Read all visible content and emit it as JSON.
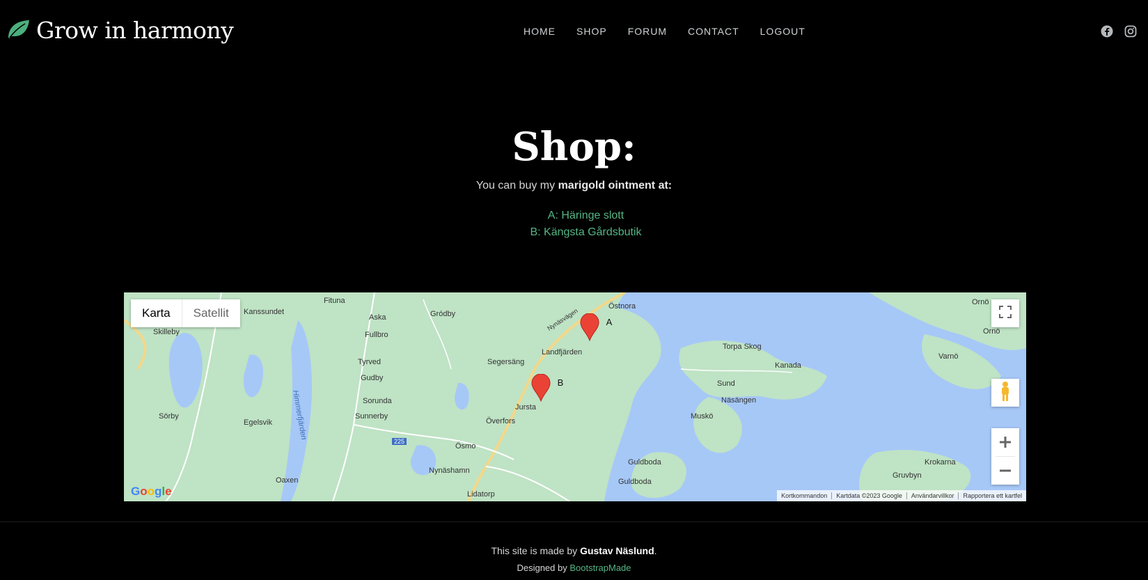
{
  "brand": {
    "name": "Grow in harmony",
    "accent": "#4caf7d"
  },
  "nav": [
    {
      "label": "HOME"
    },
    {
      "label": "SHOP"
    },
    {
      "label": "FORUM"
    },
    {
      "label": "CONTACT"
    },
    {
      "label": "LOGOUT"
    }
  ],
  "social": [
    "facebook-icon",
    "instagram-icon"
  ],
  "page": {
    "title": "Shop:",
    "intro_prefix": "You can buy my ",
    "intro_bold": "marigold ointment at:",
    "locations": [
      "A: Häringe slott",
      "B: Kängsta Gårdsbutik"
    ]
  },
  "map": {
    "type_buttons": {
      "map": "Karta",
      "satellite": "Satellit"
    },
    "markers": [
      {
        "label": "A"
      },
      {
        "label": "B"
      }
    ],
    "place_labels": [
      "Fituna",
      "Askа",
      "Gródby",
      "Östnora",
      "Ornö",
      "Kanssundet",
      "Skilleby",
      "Fullbro",
      "Nynäsvägen",
      "Landfjärden",
      "Segersäng",
      "Torpa Skog",
      "Kanada",
      "Varnö",
      "Tyrved",
      "Gudby",
      "Sorunda",
      "Sunnerby",
      "Jursta",
      "Överfors",
      "Sund",
      "Näsängen",
      "Muskö",
      "Sörby",
      "Egelsvik",
      "Himmerfjärden",
      "Ösmo",
      "Nynäshamn",
      "Guldboda",
      "Guldboda",
      "Krokarna",
      "Gruvbyn",
      "Oaxen",
      "Lidatorp",
      "225",
      "Ornö"
    ],
    "google_logo": "Google",
    "attribution": [
      "Kortkommandon",
      "Kartdata ©2023 Google",
      "Användarvillkor",
      "Rapportera ett kartfel"
    ]
  },
  "footer": {
    "made_prefix": "This site is made by ",
    "author": "Gustav Näslund",
    "made_suffix": ".",
    "designed_prefix": "Designed by ",
    "designer": "BootstrapMade"
  }
}
